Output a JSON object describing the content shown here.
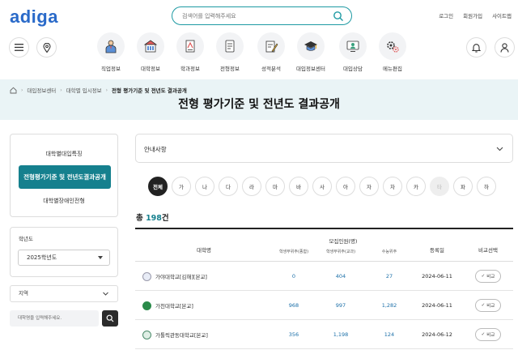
{
  "header": {
    "logo": "adiga",
    "search_placeholder": "검색어를 입력해주세요",
    "links": [
      "로그인",
      "회원가입",
      "사이트맵"
    ]
  },
  "nav": [
    {
      "label": "직업정보",
      "icon": "job-person-icon"
    },
    {
      "label": "대학정보",
      "icon": "university-building-icon"
    },
    {
      "label": "학과정보",
      "icon": "department-book-icon"
    },
    {
      "label": "전형정보",
      "icon": "admission-document-icon"
    },
    {
      "label": "성적분석",
      "icon": "score-analysis-icon"
    },
    {
      "label": "대입정보센터",
      "icon": "graduation-cap-icon"
    },
    {
      "label": "대입상담",
      "icon": "counsel-monitor-icon"
    },
    {
      "label": "메뉴편집",
      "icon": "menu-edit-gear-icon"
    }
  ],
  "breadcrumb": [
    "대입정보센터",
    "대학별 입시정보",
    "전형 평가기준 및 전년도 결과공개"
  ],
  "page_title": "전형 평가기준 및 전년도 결과공개",
  "sidebar": {
    "items": [
      "대학별대입특징",
      "전형평가기준 및 전년도결과공개",
      "대학별장애인전형"
    ],
    "active_index": 1,
    "year_title": "학년도",
    "year_value": "2025학년도",
    "region_label": "지역",
    "univ_search_placeholder": "대학명을 입력해주세요."
  },
  "notice_label": "안내사항",
  "consonants": [
    "전체",
    "가",
    "나",
    "다",
    "라",
    "마",
    "바",
    "사",
    "아",
    "자",
    "차",
    "카",
    "타",
    "파",
    "하"
  ],
  "consonant_active": 0,
  "consonant_disabled": [
    12
  ],
  "total": {
    "prefix": "총",
    "count": "198",
    "suffix": "건"
  },
  "table": {
    "headers": {
      "univ": "대학명",
      "recruit": "모집인원(명)",
      "sub1": "학생부위주(종합)",
      "sub2": "학생부위주(교과)",
      "sub3": "수능위주",
      "date": "등록일",
      "compare": "비교선택"
    },
    "compare_label": "비교",
    "rows": [
      {
        "name": "가야대학교[김해][본교]",
        "a": "0",
        "b": "404",
        "c": "27",
        "date": "2024-06-11"
      },
      {
        "name": "가천대학교[본교]",
        "a": "968",
        "b": "997",
        "c": "1,282",
        "date": "2024-06-11"
      },
      {
        "name": "가톨릭관동대학교[본교]",
        "a": "356",
        "b": "1,198",
        "c": "124",
        "date": "2024-06-12"
      }
    ]
  },
  "colors": {
    "accent": "#15808e",
    "logo": "#2a6ac9",
    "band": "#eaf4f6"
  }
}
